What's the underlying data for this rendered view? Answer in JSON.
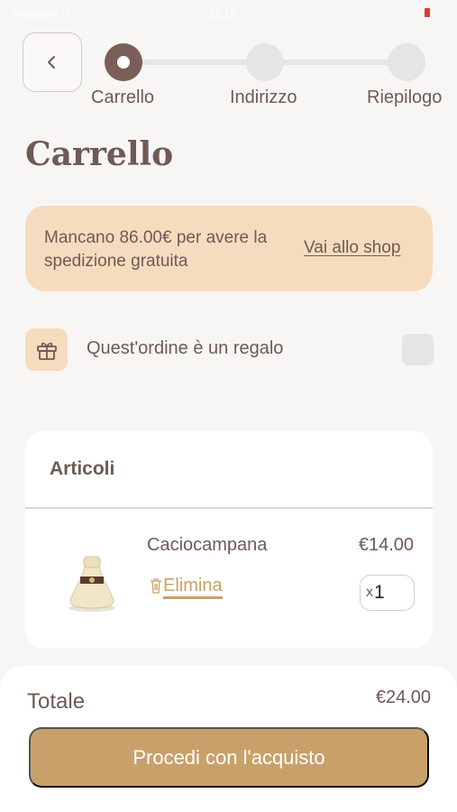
{
  "status_bar": {
    "carrier": "Vodafone IT",
    "time": "12:14"
  },
  "nav": {
    "back_icon": "chevron-left-icon"
  },
  "stepper": {
    "steps": [
      {
        "label": "Carrello",
        "active": true
      },
      {
        "label": "Indirizzo",
        "active": false
      },
      {
        "label": "Riepilogo",
        "active": false
      }
    ]
  },
  "page": {
    "title": "Carrello"
  },
  "shipping_banner": {
    "text": "Mancano 86.00€ per avere la spedizione gratuita",
    "link": "Vai allo shop"
  },
  "gift": {
    "icon": "gift-icon",
    "label": "Quest'ordine è un regalo",
    "checked": false
  },
  "items_card": {
    "title": "Articoli",
    "items": [
      {
        "name": "Caciocampana",
        "price": "€14.00",
        "delete_label": "Elimina",
        "delete_icon": "trash-icon",
        "qty_prefix": "x",
        "qty": "1"
      }
    ]
  },
  "footer": {
    "total_label": "Totale",
    "total_value": "€24.00",
    "checkout_label": "Procedi con l'acquisto"
  },
  "colors": {
    "background": "#f7f6f5",
    "text": "#6e5a55",
    "accent_gold": "#c9a06a",
    "banner": "#f6dcbe",
    "step_active": "#7a5e58",
    "step_inactive": "#e7e5e4"
  }
}
